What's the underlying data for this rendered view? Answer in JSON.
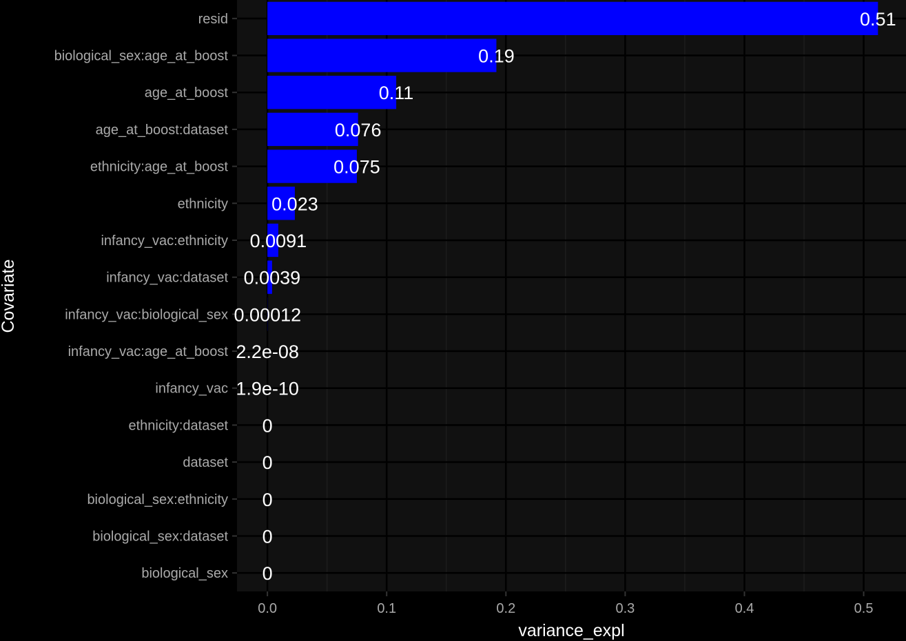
{
  "chart_data": {
    "type": "bar",
    "orientation": "horizontal",
    "xlabel": "variance_expl",
    "ylabel": "Covariate",
    "xlim": [
      -0.0255,
      0.5355
    ],
    "x_ticks": [
      0.0,
      0.1,
      0.2,
      0.3,
      0.4,
      0.5
    ],
    "x_tick_labels": [
      "0.0",
      "0.1",
      "0.2",
      "0.3",
      "0.4",
      "0.5"
    ],
    "grid": true,
    "categories": [
      "resid",
      "biological_sex:age_at_boost",
      "age_at_boost",
      "age_at_boost:dataset",
      "ethnicity:age_at_boost",
      "ethnicity",
      "infancy_vac:ethnicity",
      "infancy_vac:dataset",
      "infancy_vac:biological_sex",
      "infancy_vac:age_at_boost",
      "infancy_vac",
      "ethnicity:dataset",
      "dataset",
      "biological_sex:ethnicity",
      "biological_sex:dataset",
      "biological_sex"
    ],
    "values": [
      0.512,
      0.192,
      0.108,
      0.076,
      0.075,
      0.023,
      0.0091,
      0.0039,
      0.00012,
      2.2e-08,
      1.9e-10,
      0,
      0,
      0,
      0,
      0
    ],
    "value_labels": [
      "0.51",
      "0.19",
      "0.11",
      "0.076",
      "0.075",
      "0.023",
      "0.0091",
      "0.0039",
      "0.00012",
      "2.2e-08",
      "1.9e-10",
      "0",
      "0",
      "0",
      "0",
      "0"
    ],
    "bar_color": "#0000FF",
    "panel_color": "#111111",
    "background_color": "#000000",
    "grid_major_color": "#000000",
    "grid_minor_color": "#1d1d1d"
  }
}
